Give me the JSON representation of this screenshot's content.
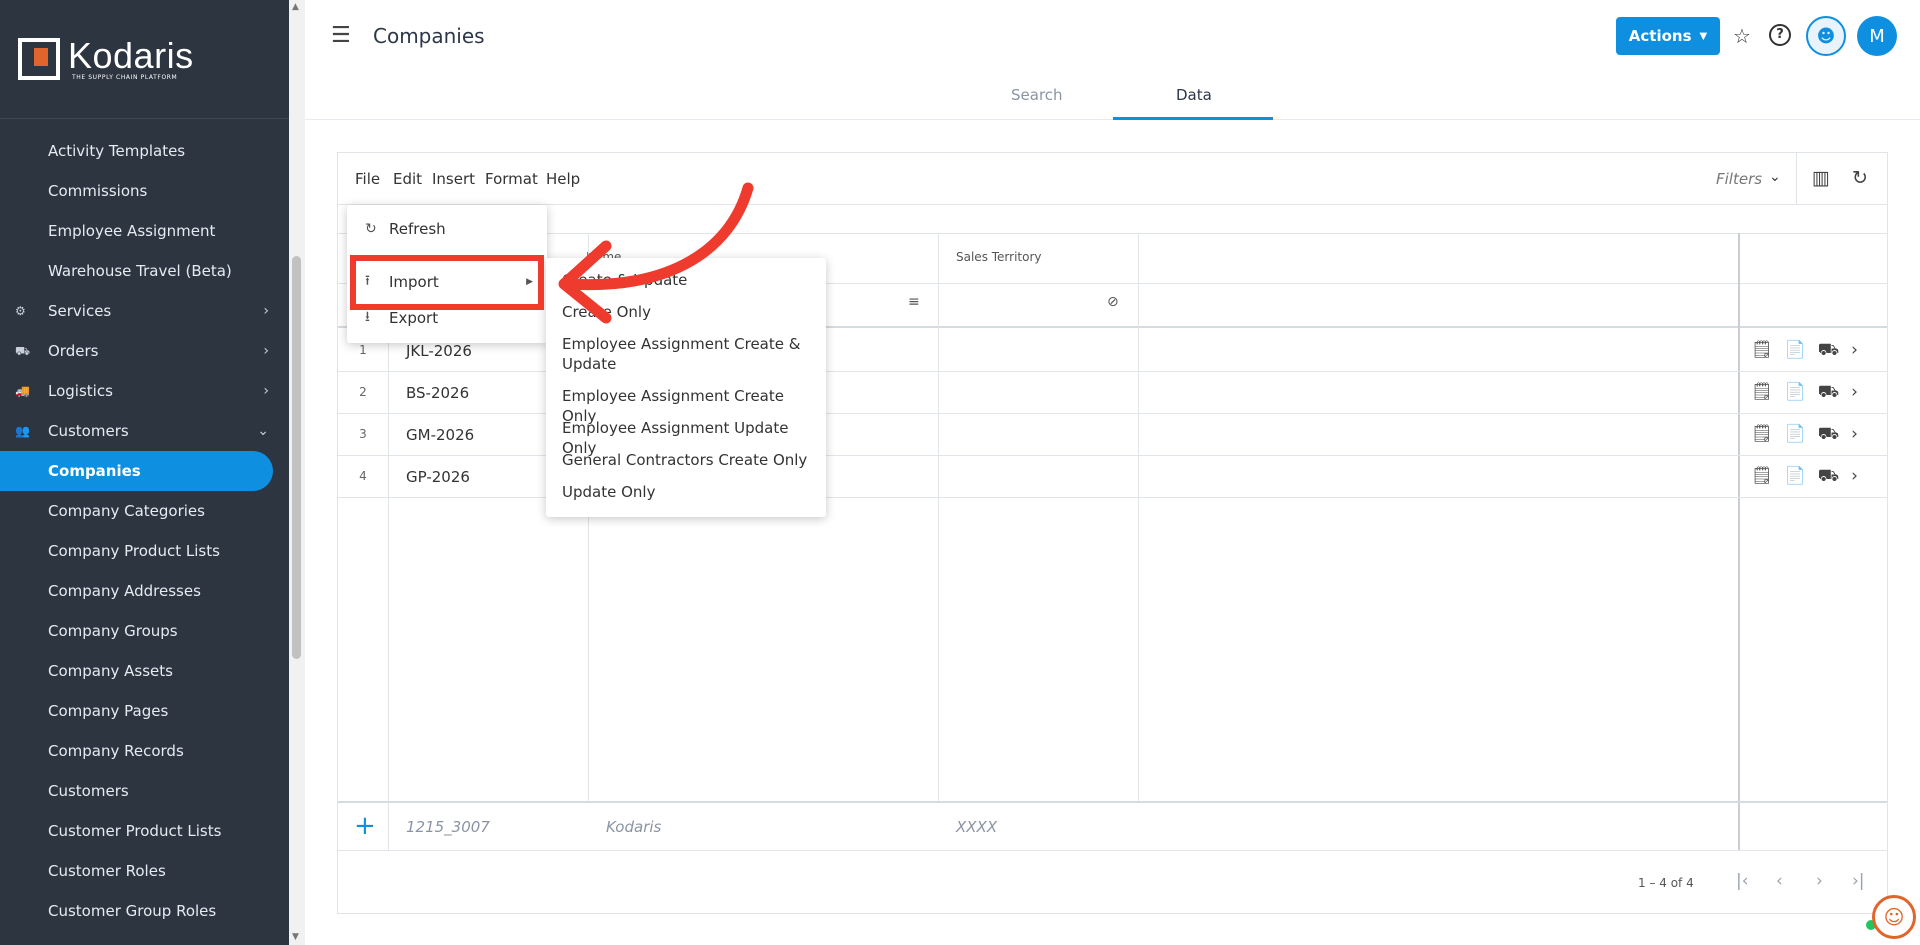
{
  "brand": {
    "name": "Kodaris",
    "tagline": "THE SUPPLY CHAIN PLATFORM",
    "accent": "#0f8fe0"
  },
  "sidebar": {
    "items": [
      {
        "label": "Activity Templates",
        "type": "link"
      },
      {
        "label": "Commissions",
        "type": "link"
      },
      {
        "label": "Employee Assignment",
        "type": "link"
      },
      {
        "label": "Warehouse Travel (Beta)",
        "type": "link"
      },
      {
        "label": "Services",
        "type": "section",
        "icon": "gears-icon",
        "expanded": false
      },
      {
        "label": "Orders",
        "type": "section",
        "icon": "truck-icon",
        "expanded": false
      },
      {
        "label": "Logistics",
        "type": "section",
        "icon": "shipping-icon",
        "expanded": false
      },
      {
        "label": "Customers",
        "type": "section",
        "icon": "people-icon",
        "expanded": true
      },
      {
        "label": "Companies",
        "type": "link",
        "active": true
      },
      {
        "label": "Company Categories",
        "type": "link"
      },
      {
        "label": "Company Product Lists",
        "type": "link"
      },
      {
        "label": "Company Addresses",
        "type": "link"
      },
      {
        "label": "Company Groups",
        "type": "link"
      },
      {
        "label": "Company Assets",
        "type": "link"
      },
      {
        "label": "Company Pages",
        "type": "link"
      },
      {
        "label": "Company Records",
        "type": "link"
      },
      {
        "label": "Customers",
        "type": "link"
      },
      {
        "label": "Customer Product Lists",
        "type": "link"
      },
      {
        "label": "Customer Roles",
        "type": "link"
      },
      {
        "label": "Customer Group Roles",
        "type": "link"
      }
    ]
  },
  "header": {
    "title": "Companies",
    "actions_label": "Actions",
    "avatar_initial": "M",
    "tabs": [
      {
        "label": "Search",
        "active": false
      },
      {
        "label": "Data",
        "active": true
      }
    ]
  },
  "grid": {
    "menu": [
      "File",
      "Edit",
      "Insert",
      "Format",
      "Help"
    ],
    "filters_label": "Filters",
    "columns": [
      "Name",
      "Sales Territory"
    ],
    "rows": [
      {
        "num": "1",
        "code": "JKL-2026"
      },
      {
        "num": "2",
        "code": "BS-2026"
      },
      {
        "num": "3",
        "code": "GM-2026"
      },
      {
        "num": "4",
        "code": "GP-2026"
      }
    ],
    "new_row_placeholders": {
      "code": "1215_3007",
      "name": "Kodaris",
      "territory": "XXXX"
    },
    "pager_text": "1 – 4 of 4"
  },
  "file_menu": {
    "items": [
      {
        "label": "Refresh",
        "icon": "refresh-icon"
      },
      {
        "label": "Import",
        "icon": "upload-icon",
        "has_submenu": true
      },
      {
        "label": "Export",
        "icon": "download-icon"
      }
    ]
  },
  "import_submenu": {
    "items": [
      "Create & Update",
      "Create Only",
      "Employee Assignment Create & Update",
      "Employee Assignment Create Only",
      "Employee Assignment Update Only",
      "General Contractors Create Only",
      "Update Only"
    ]
  },
  "annotation": {
    "highlight_color": "#ef3b2d"
  }
}
